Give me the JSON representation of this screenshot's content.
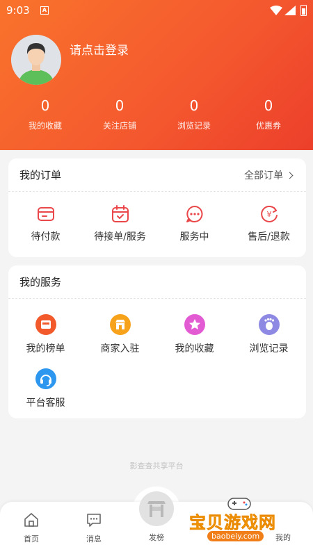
{
  "status_bar": {
    "time": "9:03",
    "notif_glyph": "A"
  },
  "profile": {
    "login_text": "请点击登录"
  },
  "stats": [
    {
      "value": "0",
      "label": "我的收藏"
    },
    {
      "value": "0",
      "label": "关注店铺"
    },
    {
      "value": "0",
      "label": "浏览记录"
    },
    {
      "value": "0",
      "label": "优惠券"
    }
  ],
  "orders": {
    "title": "我的订单",
    "all_label": "全部订单",
    "items": [
      {
        "label": "待付款",
        "icon": "wallet-icon"
      },
      {
        "label": "待接单/服务",
        "icon": "calendar-check-icon"
      },
      {
        "label": "服务中",
        "icon": "chat-dots-icon"
      },
      {
        "label": "售后/退款",
        "icon": "yuan-refund-icon"
      }
    ]
  },
  "services": {
    "title": "我的服务",
    "items": [
      {
        "label": "我的榜单",
        "icon": "ranking-icon",
        "color": "#f25a2c"
      },
      {
        "label": "商家入驻",
        "icon": "merchant-icon",
        "color": "#f7a21b"
      },
      {
        "label": "我的收藏",
        "icon": "star-icon",
        "color": "#e25bd3"
      },
      {
        "label": "浏览记录",
        "icon": "footprint-icon",
        "color": "#8e8ae3"
      },
      {
        "label": "平台客服",
        "icon": "headset-icon",
        "color": "#2d97f0"
      }
    ]
  },
  "footer_text": "影查查共享平台",
  "tabbar": {
    "tabs": [
      {
        "label": "首页",
        "icon": "home-icon"
      },
      {
        "label": "消息",
        "icon": "message-icon"
      },
      {
        "label": "发榜",
        "icon": "publish-icon"
      },
      {
        "label": "我的",
        "icon": "profile-icon"
      }
    ]
  },
  "watermark": {
    "title": "宝贝游戏网",
    "url": "baobeiy.com"
  },
  "colors": {
    "accent": "#f4572e",
    "accent_dark": "#ec3f2b",
    "icon_red": "#e9474a"
  }
}
